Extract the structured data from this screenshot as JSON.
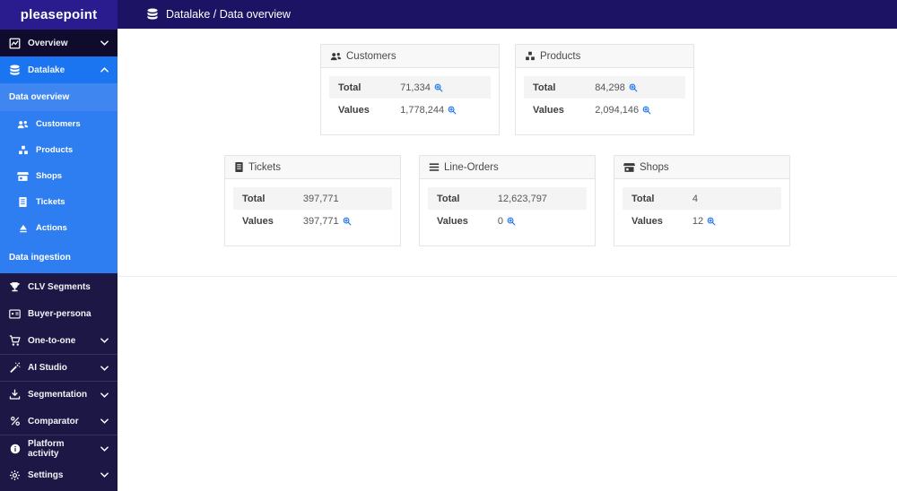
{
  "brand": {
    "name": "pleasepoint"
  },
  "header": {
    "title": "Datalake / Data overview",
    "icon": "database-icon"
  },
  "colors": {
    "accent_blue": "#1b74f0",
    "submenu_blue": "#2e7ef2",
    "selected_blue": "#3f86f0",
    "logo_bg": "#2a1b8e",
    "topbar_bg": "#1d1365",
    "sidebar_bg": "#1c1745",
    "zoom_icon": "#1a73e8"
  },
  "sidebar": {
    "items": [
      {
        "label": "Overview",
        "icon": "chart-line-icon",
        "chevron": "down"
      },
      {
        "label": "Datalake",
        "icon": "database-icon",
        "chevron": "up",
        "active": true
      },
      {
        "label": "Data overview",
        "type": "subheader",
        "selected": true
      },
      {
        "label": "Customers",
        "icon": "users-icon",
        "type": "subitem"
      },
      {
        "label": "Products",
        "icon": "cubes-icon",
        "type": "subitem"
      },
      {
        "label": "Shops",
        "icon": "store-icon",
        "type": "subitem"
      },
      {
        "label": "Tickets",
        "icon": "receipt-icon",
        "type": "subitem"
      },
      {
        "label": "Actions",
        "icon": "bell-icon",
        "type": "subitem"
      },
      {
        "label": "Data ingestion",
        "type": "subheader"
      },
      {
        "label": "CLV Segments",
        "icon": "trophy-icon"
      },
      {
        "label": "Buyer-persona",
        "icon": "id-card-icon"
      },
      {
        "label": "One-to-one",
        "icon": "cart-icon",
        "chevron": "down"
      },
      {
        "label": "AI Studio",
        "icon": "wand-icon",
        "chevron": "down"
      },
      {
        "label": "Segmentation",
        "icon": "download-icon",
        "chevron": "down"
      },
      {
        "label": "Comparator",
        "icon": "percent-icon",
        "chevron": "down"
      },
      {
        "label": "Platform activity",
        "icon": "info-icon",
        "chevron": "down"
      },
      {
        "label": "Settings",
        "icon": "gear-icon",
        "chevron": "down"
      }
    ]
  },
  "cards": [
    {
      "title": "Customers",
      "icon": "users-icon",
      "rows": [
        {
          "label": "Total",
          "value": "71,334",
          "zoom": true
        },
        {
          "label": "Values",
          "value": "1,778,244",
          "zoom": true
        }
      ]
    },
    {
      "title": "Products",
      "icon": "cubes-icon",
      "rows": [
        {
          "label": "Total",
          "value": "84,298",
          "zoom": true
        },
        {
          "label": "Values",
          "value": "2,094,146",
          "zoom": true
        }
      ]
    },
    {
      "title": "Tickets",
      "icon": "receipt-icon",
      "rows": [
        {
          "label": "Total",
          "value": "397,771",
          "zoom": false
        },
        {
          "label": "Values",
          "value": "397,771",
          "zoom": true
        }
      ]
    },
    {
      "title": "Line-Orders",
      "icon": "list-icon",
      "rows": [
        {
          "label": "Total",
          "value": "12,623,797",
          "zoom": false
        },
        {
          "label": "Values",
          "value": "0",
          "zoom": true
        }
      ]
    },
    {
      "title": "Shops",
      "icon": "store-icon",
      "rows": [
        {
          "label": "Total",
          "value": "4",
          "zoom": false
        },
        {
          "label": "Values",
          "value": "12",
          "zoom": true
        }
      ]
    }
  ]
}
